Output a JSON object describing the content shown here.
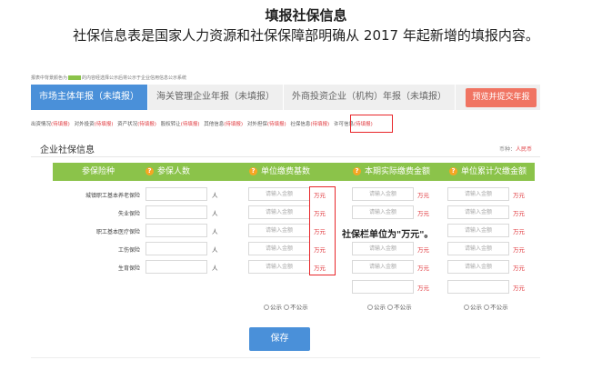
{
  "title": "填报社保信息",
  "subtitle": "社保信息表是国家人力资源和社保保障部明确从 2017 年起新增的填报内容。",
  "note": {
    "before": "报表中背景颜色为",
    "after": "的内容经选择公示后将公示于企业信用信息公示系统"
  },
  "tabs": [
    {
      "label": "市场主体年报（未填报）",
      "active": true
    },
    {
      "label": "海关管理企业年报（未填报）",
      "active": false
    },
    {
      "label": "外商投资企业（机构）年报（未填报）",
      "active": false
    }
  ],
  "submit_button": "预览并提交年报",
  "subnav": [
    {
      "label": "出资情况",
      "status": "(待填报)"
    },
    {
      "label": "对外投资",
      "status": "(待填报)"
    },
    {
      "label": "资产状况",
      "status": "(待填报)"
    },
    {
      "label": "股权转让",
      "status": "(待填报)"
    },
    {
      "label": "其他信息",
      "status": "(待填报)"
    },
    {
      "label": "对外担保",
      "status": "(待填报)"
    },
    {
      "label": "社保信息",
      "status": "(待填报)"
    },
    {
      "label": "许可信息",
      "status": "(待填报)"
    }
  ],
  "panel": {
    "title": "企业社保信息",
    "hint_label": "币种：",
    "hint_value": "人民币"
  },
  "headers": [
    "参保险种",
    "参保人数",
    "单位缴费基数",
    "本期实际缴费金额",
    "单位累计欠缴金额"
  ],
  "rows": [
    {
      "label": "城镇职工基本养老保险",
      "unit": "人"
    },
    {
      "label": "失业保险",
      "unit": "人"
    },
    {
      "label": "职工基本医疗保险",
      "unit": "人"
    },
    {
      "label": "工伤保险",
      "unit": "人"
    },
    {
      "label": "生育保险",
      "unit": "人"
    }
  ],
  "placeholder": "请输入金额",
  "money_unit": "万元",
  "callout": "社保栏单位为\"万元\"。",
  "radio": {
    "public": "公示",
    "private": "不公示"
  },
  "save_button": "保存",
  "colors": {
    "tab_active": "#4a90d9",
    "header_green": "#8bc34a",
    "submit": "#f07462",
    "highlight_red": "#e8262a"
  }
}
